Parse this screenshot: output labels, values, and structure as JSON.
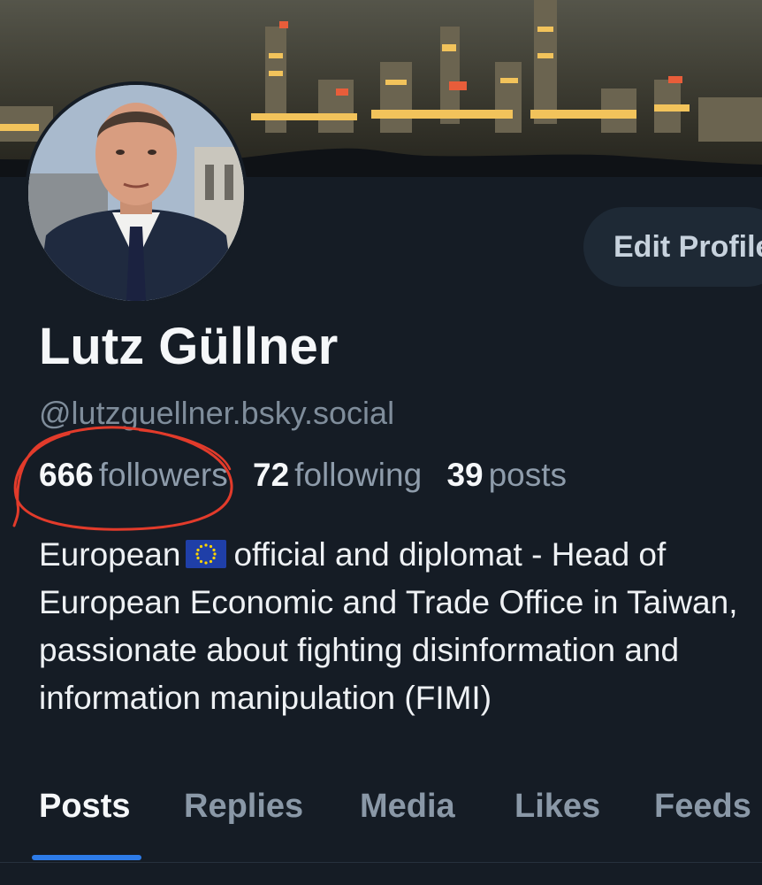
{
  "profile": {
    "display_name": "Lutz Güllner",
    "handle": "@lutzguellner.bsky.social",
    "edit_button_label": "Edit Profile"
  },
  "stats": {
    "followers_count": "666",
    "followers_label": "followers",
    "following_count": "72",
    "following_label": "following",
    "posts_count": "39",
    "posts_label": "posts"
  },
  "bio": {
    "line1_before_flag": "European",
    "line1_after_flag": "official and diplomat - Head of",
    "line2": "European Economic and Trade Office in Taiwan,",
    "line3": "passionate about fighting disinformation and",
    "line4": "information manipulation (FIMI)"
  },
  "tabs": [
    {
      "label": "Posts",
      "active": true
    },
    {
      "label": "Replies",
      "active": false
    },
    {
      "label": "Media",
      "active": false
    },
    {
      "label": "Likes",
      "active": false
    },
    {
      "label": "Feeds",
      "active": false
    }
  ],
  "colors": {
    "background": "#151c25",
    "accent": "#2d7be8",
    "annotation": "#e23b2b"
  }
}
